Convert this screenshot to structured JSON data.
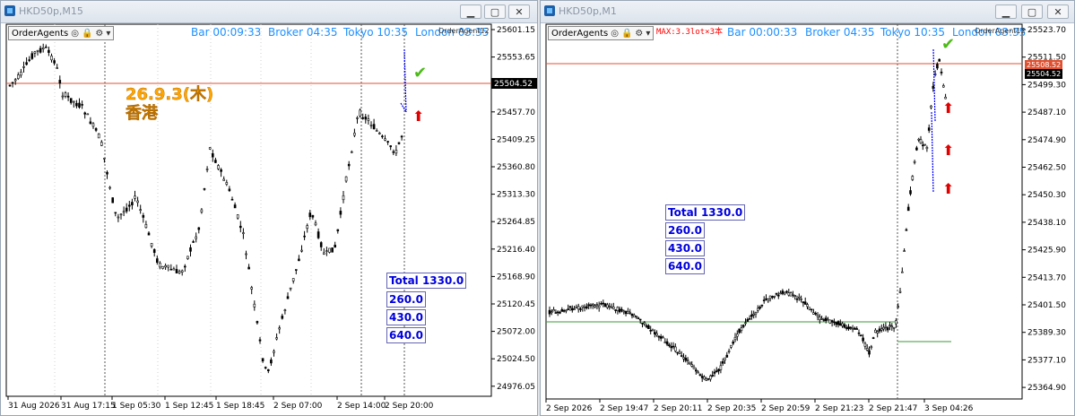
{
  "left": {
    "title": "HKD50p,M15",
    "toolbar_label": "OrderAgents",
    "bar_timer": "Bar 00:09:33",
    "broker_time": "Broker 04:35",
    "tokyo_time": "Tokyo 10:35",
    "london_time": "London 03:35",
    "order_agent_tag": "OrderAgent12",
    "annotation_date": "26.9.3(木)",
    "annotation_place": "香港",
    "current_price": "25504.52",
    "totals": [
      "Total 1330.0",
      "260.0",
      "430.0",
      "640.0"
    ],
    "y_ticks": [
      "25601.15",
      "25553.65",
      "25504.52",
      "25457.70",
      "25409.25",
      "25360.80",
      "25313.30",
      "25264.85",
      "25216.40",
      "25168.90",
      "25120.45",
      "25072.00",
      "25024.50",
      "24976.05"
    ],
    "x_ticks": [
      "31 Aug 2026",
      "31 Aug 17:15",
      "1 Sep 05:30",
      "1 Sep 12:45",
      "1 Sep 18:45",
      "2 Sep 07:00",
      "2 Sep 14:00",
      "2 Sep 20:00"
    ]
  },
  "right": {
    "title": "HKD50p,M1",
    "toolbar_label": "OrderAgents",
    "max_text": "MAX:3.3lot×3本",
    "bar_timer": "Bar 00:00:33",
    "broker_time": "Broker 04:35",
    "tokyo_time": "Tokyo 10:35",
    "london_time": "London 03:35",
    "order_agent_tag": "OrderAgent12",
    "price_tag_red": "25508.52",
    "price_tag_dark": "25504.52",
    "totals": [
      "Total 1330.0",
      "260.0",
      "430.0",
      "640.0"
    ],
    "y_ticks": [
      "25523.70",
      "25511.50",
      "25499.30",
      "25487.10",
      "25474.90",
      "25462.50",
      "25450.30",
      "25438.10",
      "25425.90",
      "25413.70",
      "25401.50",
      "25389.30",
      "25377.10",
      "25364.90"
    ],
    "x_ticks": [
      "2 Sep 2026",
      "2 Sep 19:47",
      "2 Sep 20:11",
      "2 Sep 20:35",
      "2 Sep 20:59",
      "2 Sep 21:23",
      "2 Sep 21:47",
      "3 Sep 04:26"
    ]
  },
  "colors": {
    "bull": "#000000",
    "grid": "#c8c8c8",
    "price_line": "#e05030",
    "green_line": "#3a9a3a",
    "label_blue": "#0000dd",
    "accent_orange": "#ff8c00"
  }
}
